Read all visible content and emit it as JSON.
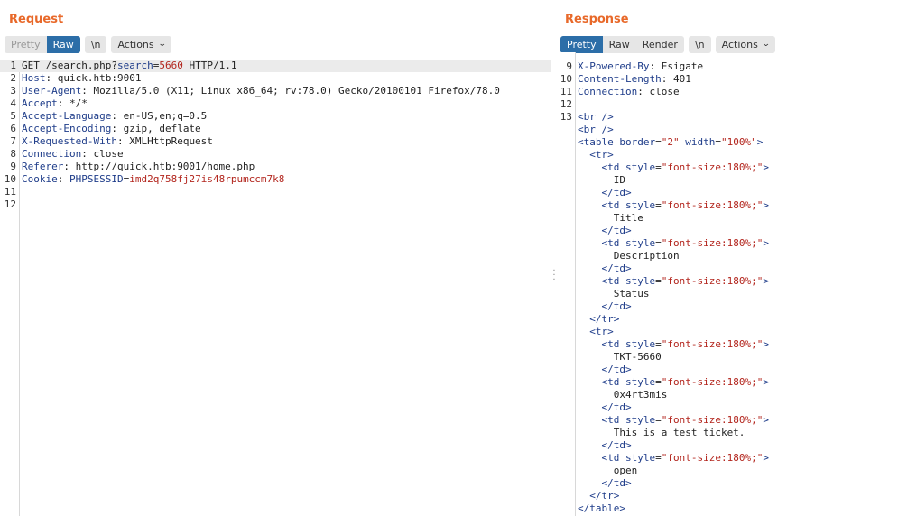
{
  "request": {
    "title": "Request",
    "modes": [
      "Pretty",
      "Raw"
    ],
    "active_mode": "Raw",
    "newline_label": "\\n",
    "actions_label": "Actions",
    "lines": [
      {
        "n": "1",
        "parts": [
          [
            "txt",
            "GET /search.php?"
          ],
          [
            "k",
            "search"
          ],
          [
            "txt",
            "="
          ],
          [
            "v",
            "5660"
          ],
          [
            "txt",
            " HTTP/1.1"
          ]
        ]
      },
      {
        "n": "2",
        "parts": [
          [
            "k",
            "Host"
          ],
          [
            "txt",
            ": quick.htb:9001"
          ]
        ]
      },
      {
        "n": "3",
        "parts": [
          [
            "k",
            "User-Agent"
          ],
          [
            "txt",
            ": Mozilla/5.0 (X11; Linux x86_64; rv:78.0) Gecko/20100101 Firefox/78.0"
          ]
        ]
      },
      {
        "n": "4",
        "parts": [
          [
            "k",
            "Accept"
          ],
          [
            "txt",
            ": */*"
          ]
        ]
      },
      {
        "n": "5",
        "parts": [
          [
            "k",
            "Accept-Language"
          ],
          [
            "txt",
            ": en-US,en;q=0.5"
          ]
        ]
      },
      {
        "n": "6",
        "parts": [
          [
            "k",
            "Accept-Encoding"
          ],
          [
            "txt",
            ": gzip, deflate"
          ]
        ]
      },
      {
        "n": "7",
        "parts": [
          [
            "k",
            "X-Requested-With"
          ],
          [
            "txt",
            ": XMLHttpRequest"
          ]
        ]
      },
      {
        "n": "8",
        "parts": [
          [
            "k",
            "Connection"
          ],
          [
            "txt",
            ": close"
          ]
        ]
      },
      {
        "n": "9",
        "parts": [
          [
            "k",
            "Referer"
          ],
          [
            "txt",
            ": http://quick.htb:9001/home.php"
          ]
        ]
      },
      {
        "n": "10",
        "parts": [
          [
            "k",
            "Cookie"
          ],
          [
            "txt",
            ": "
          ],
          [
            "k",
            "PHPSESSID"
          ],
          [
            "txt",
            "="
          ],
          [
            "v",
            "imd2q758fj27is48rpumccm7k8"
          ]
        ]
      },
      {
        "n": "11",
        "parts": []
      },
      {
        "n": "12",
        "parts": []
      }
    ]
  },
  "response": {
    "title": "Response",
    "modes": [
      "Pretty",
      "Raw",
      "Render"
    ],
    "active_mode": "Pretty",
    "newline_label": "\\n",
    "actions_label": "Actions",
    "lines": [
      {
        "n": "9",
        "parts": [
          [
            "k",
            "X-Powered-By"
          ],
          [
            "txt",
            ": Esigate"
          ]
        ]
      },
      {
        "n": "10",
        "parts": [
          [
            "k",
            "Content-Length"
          ],
          [
            "txt",
            ": 401"
          ]
        ]
      },
      {
        "n": "11",
        "parts": [
          [
            "k",
            "Connection"
          ],
          [
            "txt",
            ": close"
          ]
        ]
      },
      {
        "n": "12",
        "parts": []
      },
      {
        "n": "13",
        "parts": [
          [
            "tag",
            "<br />"
          ]
        ]
      },
      {
        "n": "",
        "parts": [
          [
            "tag",
            "<br />"
          ]
        ]
      },
      {
        "n": "",
        "parts": [
          [
            "tag",
            "<table "
          ],
          [
            "attr",
            "border"
          ],
          [
            "txt",
            "="
          ],
          [
            "str",
            "\"2\""
          ],
          [
            "attr",
            " width"
          ],
          [
            "txt",
            "="
          ],
          [
            "str",
            "\"100%\""
          ],
          [
            "tag",
            ">"
          ]
        ]
      },
      {
        "n": "",
        "parts": [
          [
            "txt",
            "  "
          ],
          [
            "tag",
            "<tr>"
          ]
        ]
      },
      {
        "n": "",
        "parts": [
          [
            "txt",
            "    "
          ],
          [
            "tag",
            "<td "
          ],
          [
            "attr",
            "style"
          ],
          [
            "txt",
            "="
          ],
          [
            "str",
            "\"font-size:180%;\""
          ],
          [
            "tag",
            ">"
          ]
        ]
      },
      {
        "n": "",
        "parts": [
          [
            "txt",
            "      ID"
          ]
        ]
      },
      {
        "n": "",
        "parts": [
          [
            "txt",
            "    "
          ],
          [
            "tag",
            "</td>"
          ]
        ]
      },
      {
        "n": "",
        "parts": [
          [
            "txt",
            "    "
          ],
          [
            "tag",
            "<td "
          ],
          [
            "attr",
            "style"
          ],
          [
            "txt",
            "="
          ],
          [
            "str",
            "\"font-size:180%;\""
          ],
          [
            "tag",
            ">"
          ]
        ]
      },
      {
        "n": "",
        "parts": [
          [
            "txt",
            "      Title"
          ]
        ]
      },
      {
        "n": "",
        "parts": [
          [
            "txt",
            "    "
          ],
          [
            "tag",
            "</td>"
          ]
        ]
      },
      {
        "n": "",
        "parts": [
          [
            "txt",
            "    "
          ],
          [
            "tag",
            "<td "
          ],
          [
            "attr",
            "style"
          ],
          [
            "txt",
            "="
          ],
          [
            "str",
            "\"font-size:180%;\""
          ],
          [
            "tag",
            ">"
          ]
        ]
      },
      {
        "n": "",
        "parts": [
          [
            "txt",
            "      Description"
          ]
        ]
      },
      {
        "n": "",
        "parts": [
          [
            "txt",
            "    "
          ],
          [
            "tag",
            "</td>"
          ]
        ]
      },
      {
        "n": "",
        "parts": [
          [
            "txt",
            "    "
          ],
          [
            "tag",
            "<td "
          ],
          [
            "attr",
            "style"
          ],
          [
            "txt",
            "="
          ],
          [
            "str",
            "\"font-size:180%;\""
          ],
          [
            "tag",
            ">"
          ]
        ]
      },
      {
        "n": "",
        "parts": [
          [
            "txt",
            "      Status"
          ]
        ]
      },
      {
        "n": "",
        "parts": [
          [
            "txt",
            "    "
          ],
          [
            "tag",
            "</td>"
          ]
        ]
      },
      {
        "n": "",
        "parts": [
          [
            "txt",
            "  "
          ],
          [
            "tag",
            "</tr>"
          ]
        ]
      },
      {
        "n": "",
        "parts": [
          [
            "txt",
            "  "
          ],
          [
            "tag",
            "<tr>"
          ]
        ]
      },
      {
        "n": "",
        "parts": [
          [
            "txt",
            "    "
          ],
          [
            "tag",
            "<td "
          ],
          [
            "attr",
            "style"
          ],
          [
            "txt",
            "="
          ],
          [
            "str",
            "\"font-size:180%;\""
          ],
          [
            "tag",
            ">"
          ]
        ]
      },
      {
        "n": "",
        "parts": [
          [
            "txt",
            "      TKT-5660"
          ]
        ]
      },
      {
        "n": "",
        "parts": [
          [
            "txt",
            "    "
          ],
          [
            "tag",
            "</td>"
          ]
        ]
      },
      {
        "n": "",
        "parts": [
          [
            "txt",
            "    "
          ],
          [
            "tag",
            "<td "
          ],
          [
            "attr",
            "style"
          ],
          [
            "txt",
            "="
          ],
          [
            "str",
            "\"font-size:180%;\""
          ],
          [
            "tag",
            ">"
          ]
        ]
      },
      {
        "n": "",
        "parts": [
          [
            "txt",
            "      0x4rt3mis"
          ]
        ]
      },
      {
        "n": "",
        "parts": [
          [
            "txt",
            "    "
          ],
          [
            "tag",
            "</td>"
          ]
        ]
      },
      {
        "n": "",
        "parts": [
          [
            "txt",
            "    "
          ],
          [
            "tag",
            "<td "
          ],
          [
            "attr",
            "style"
          ],
          [
            "txt",
            "="
          ],
          [
            "str",
            "\"font-size:180%;\""
          ],
          [
            "tag",
            ">"
          ]
        ]
      },
      {
        "n": "",
        "parts": [
          [
            "txt",
            "      This is a test ticket."
          ]
        ]
      },
      {
        "n": "",
        "parts": [
          [
            "txt",
            "    "
          ],
          [
            "tag",
            "</td>"
          ]
        ]
      },
      {
        "n": "",
        "parts": [
          [
            "txt",
            "    "
          ],
          [
            "tag",
            "<td "
          ],
          [
            "attr",
            "style"
          ],
          [
            "txt",
            "="
          ],
          [
            "str",
            "\"font-size:180%;\""
          ],
          [
            "tag",
            ">"
          ]
        ]
      },
      {
        "n": "",
        "parts": [
          [
            "txt",
            "      open"
          ]
        ]
      },
      {
        "n": "",
        "parts": [
          [
            "txt",
            "    "
          ],
          [
            "tag",
            "</td>"
          ]
        ]
      },
      {
        "n": "",
        "parts": [
          [
            "txt",
            "  "
          ],
          [
            "tag",
            "</tr>"
          ]
        ]
      },
      {
        "n": "",
        "parts": [
          [
            "tag",
            "</table>"
          ]
        ]
      }
    ]
  },
  "icons": {
    "chevron": "chevron-down-icon",
    "divider_grip": "drag-handle-icon"
  }
}
